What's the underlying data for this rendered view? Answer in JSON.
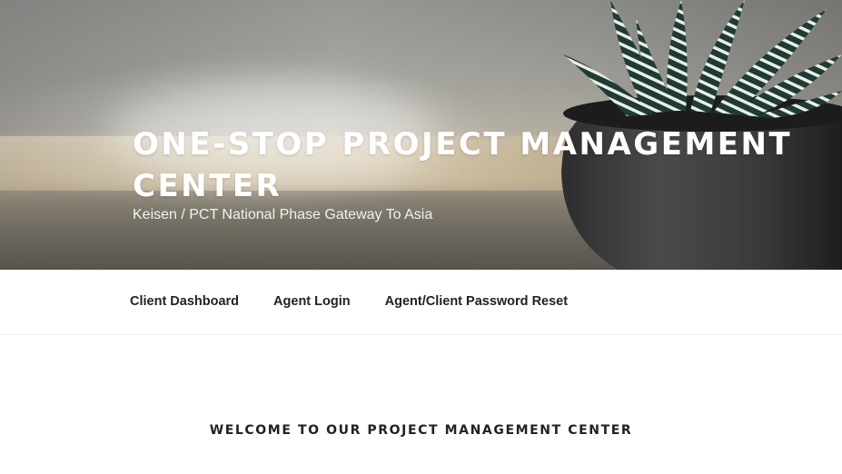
{
  "header": {
    "site_title": "ONE-STOP PROJECT MANAGEMENT CENTER",
    "site_description": "Keisen / PCT National Phase Gateway To Asia"
  },
  "nav": {
    "items": [
      {
        "label": "Client Dashboard"
      },
      {
        "label": "Agent Login"
      },
      {
        "label": "Agent/Client Password Reset"
      }
    ]
  },
  "main": {
    "heading": "WELCOME TO OUR PROJECT MANAGEMENT CENTER"
  },
  "colors": {
    "title_text": "#ffffff",
    "nav_text": "#222222",
    "pot": "#3a3a3c",
    "leaf_dark": "#1f3b34",
    "leaf_stripe": "#e8efe9"
  }
}
